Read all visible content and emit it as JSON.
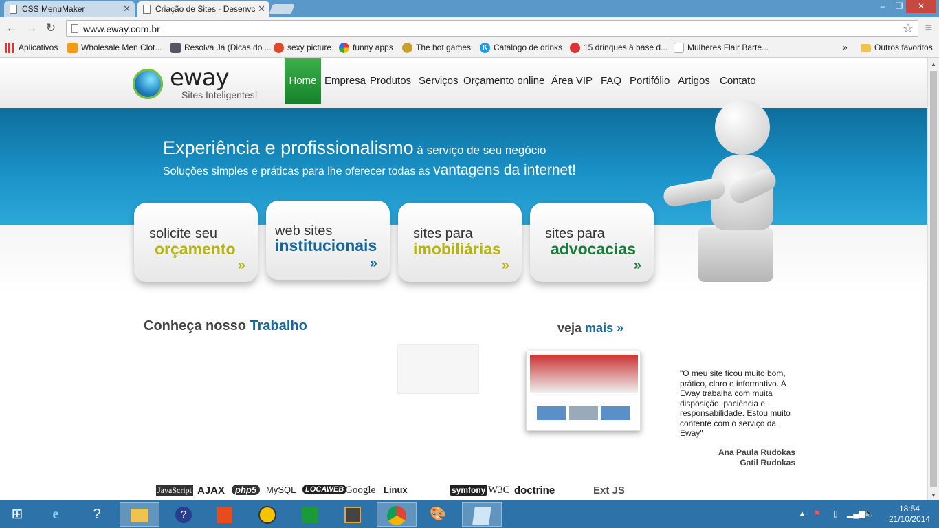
{
  "browser": {
    "tabs": [
      {
        "title": "CSS MenuMaker",
        "active": false
      },
      {
        "title": "Criação de Sites - Desenvc",
        "active": true
      }
    ],
    "url": "www.eway.com.br",
    "bookmarks": [
      {
        "label": "Aplicativos",
        "icon": "apps-grid-icon"
      },
      {
        "label": "Wholesale Men Clot...",
        "icon": "cart-icon"
      },
      {
        "label": "Resolva Já (Dicas do ...",
        "icon": "eye-icon"
      },
      {
        "label": "sexy picture",
        "icon": "pin-icon"
      },
      {
        "label": "funny apps",
        "icon": "google-icon"
      },
      {
        "label": "The hot games",
        "icon": "game-icon"
      },
      {
        "label": "Catálogo de drinks",
        "icon": "k-icon"
      },
      {
        "label": "15 drinques à base d...",
        "icon": "drink-icon"
      },
      {
        "label": "Mulheres Flair Barte...",
        "icon": "doc-icon"
      }
    ],
    "bookmarks_more": "»",
    "other_bookmarks": "Outros favoritos"
  },
  "site": {
    "logo": {
      "name": "eway",
      "tagline": "Sites Inteligentes!"
    },
    "nav": [
      "Home",
      "Empresa",
      "Produtos",
      "Serviços",
      "Orçamento online",
      "Área VIP",
      "FAQ",
      "Portifólio",
      "Artigos",
      "Contato"
    ],
    "headline": {
      "main": "Experiência e profissionalismo",
      "small": " à serviço de seu negócio"
    },
    "subline": {
      "text": "Soluções simples e práticas para lhe oferecer todas as ",
      "emph": "vantagens da internet!"
    },
    "boxes": [
      {
        "l1": "solicite seu",
        "l2": "orçamento",
        "color": "#b5b50b",
        "arrow": "»"
      },
      {
        "l1": "web sites",
        "l2": "institucionais",
        "color": "#16689b",
        "arrow": "»"
      },
      {
        "l1": "sites para",
        "l2": "imobiliárias",
        "color": "#b5b50b",
        "arrow": "»"
      },
      {
        "l1": "sites para",
        "l2": "advocacias",
        "color": "#1a7a3a",
        "arrow": "»"
      }
    ],
    "work": {
      "title": "Conheça nosso ",
      "emph": "Trabalho",
      "more": "veja ",
      "more_emph": "mais",
      "more_arrow": "»"
    },
    "testimonial": {
      "quote": "\"O meu site ficou muito bom, prático, claro e informativo. A Eway trabalha com muita disposição, paciência e responsabilidade. Estou muito contente com o serviço da Eway\"",
      "author": "Ana Paula Rudokas",
      "company": "Gatil Rudokas"
    },
    "tech_logos": [
      "JavaScript",
      "AJAX",
      "php5",
      "MySQL",
      "LOCAWEB",
      "Google",
      "Linux",
      "symfony",
      "W3C",
      "doctrine",
      "Ext JS"
    ]
  },
  "taskbar": {
    "apps": [
      "windows-icon",
      "ie-icon",
      "help-icon",
      "explorer-icon",
      "app-icon",
      "office-icon",
      "globe-icon",
      "store-icon",
      "sublime-icon",
      "chrome-icon",
      "paint-icon",
      "notes-icon"
    ],
    "time": "18:54",
    "date": "21/10/2014"
  }
}
